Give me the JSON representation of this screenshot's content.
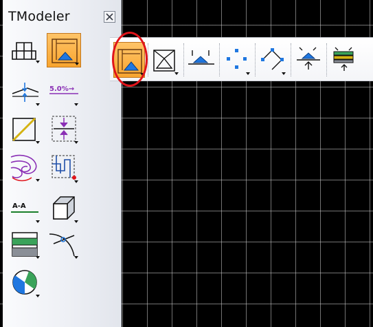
{
  "palette": {
    "title": "TModeler",
    "close_icon": "close-box-icon",
    "tools": [
      {
        "icon": "site-structure-icon"
      },
      {
        "icon": "volume-surface-icon",
        "active": true
      },
      {
        "icon": "slope-line-icon"
      },
      {
        "icon": "grade-percent-icon",
        "label": "5.0%→"
      },
      {
        "icon": "diagonal-box-icon"
      },
      {
        "icon": "elevation-adjust-icon"
      },
      {
        "icon": "contour-lines-icon"
      },
      {
        "icon": "grid-path-icon"
      },
      {
        "icon": "section-cut-icon",
        "label": "A-A"
      },
      {
        "icon": "3d-box-icon"
      },
      {
        "icon": "hatch-panel-icon"
      },
      {
        "icon": "curve-intersection-icon"
      },
      {
        "icon": "globe-shading-icon"
      }
    ]
  },
  "toolbar": {
    "items": [
      {
        "icon": "volume-surface-icon",
        "active": true
      },
      {
        "icon": "terrain-frame-icon"
      },
      {
        "icon": "flat-pad-icon"
      },
      {
        "icon": "point-grid-icon"
      },
      {
        "icon": "diamond-points-icon"
      },
      {
        "icon": "raise-lower-pad-icon"
      },
      {
        "icon": "layered-pad-icon"
      }
    ]
  },
  "colors": {
    "active_bg": "#f8a52f",
    "highlight_ring": "#e0141b",
    "canvas_bg": "#000000",
    "icon_blue": "#1f77e0",
    "icon_purple": "#8a2fb5"
  }
}
